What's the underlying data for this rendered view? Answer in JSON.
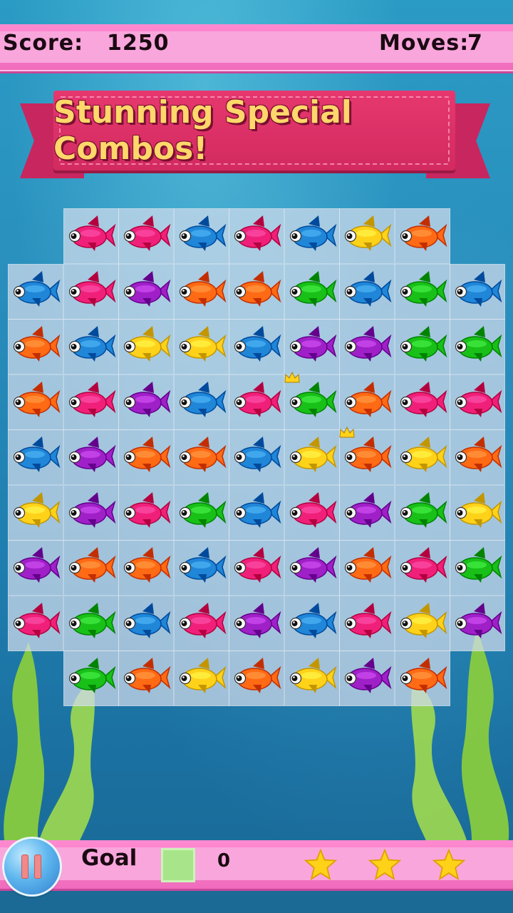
{
  "hud": {
    "score_label": "Score:",
    "score_value": "1250",
    "moves_label": "Moves:",
    "moves_value": "7"
  },
  "banner": {
    "text": "Stunning Special Combos!"
  },
  "footer": {
    "goal_label": "Goal",
    "goal_count": "0",
    "goal_color": "#a8e58a",
    "stars": 3
  },
  "palette": {
    "pink": "#f0207a",
    "blue": "#1f86d8",
    "purple": "#a020c8",
    "orange": "#ff6a14",
    "green": "#18c018",
    "yellow": "#ffd21a"
  },
  "board": {
    "rows": [
      [
        "",
        "pink",
        "pink",
        "blue",
        "pink",
        "blue",
        "yellow",
        "orange",
        ""
      ],
      [
        "blue",
        "pink",
        "purple",
        "orange",
        "orange",
        "green",
        "blue",
        "green",
        "blue"
      ],
      [
        "orange",
        "blue",
        "yellow",
        "yellow",
        "blue",
        "purple",
        "purple",
        "green",
        "green"
      ],
      [
        "orange",
        "pink",
        "purple",
        "blue",
        "pink",
        "green*",
        "orange",
        "pink",
        "pink"
      ],
      [
        "blue",
        "purple",
        "orange",
        "orange",
        "blue",
        "yellow",
        "orange*",
        "yellow",
        "orange"
      ],
      [
        "yellow",
        "purple",
        "pink",
        "green",
        "blue",
        "pink",
        "purple",
        "green",
        "yellow"
      ],
      [
        "purple",
        "orange",
        "orange",
        "blue",
        "pink",
        "purple",
        "orange",
        "pink",
        "green"
      ],
      [
        "pink",
        "green",
        "blue",
        "pink",
        "purple",
        "blue",
        "pink",
        "yellow",
        "purple"
      ],
      [
        "",
        "green",
        "orange",
        "yellow",
        "orange",
        "yellow",
        "purple",
        "orange",
        ""
      ]
    ]
  }
}
